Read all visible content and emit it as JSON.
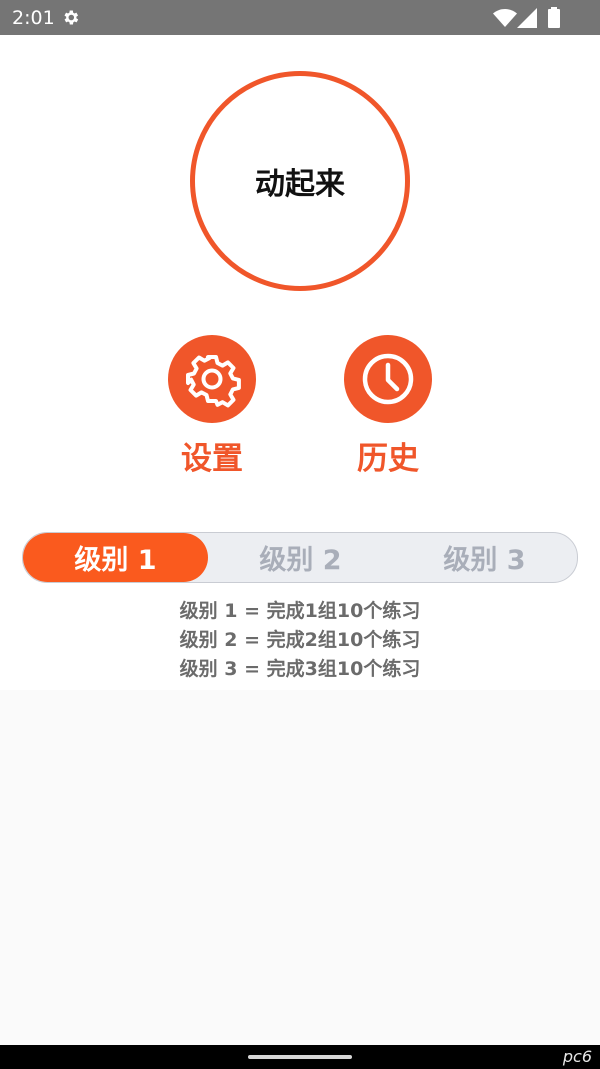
{
  "status_bar": {
    "time": "2:01",
    "icons": [
      "gear-icon",
      "wifi-icon",
      "signal-icon",
      "battery-icon"
    ]
  },
  "main": {
    "start_label": "动起来",
    "settings_label": "设置",
    "history_label": "历史",
    "levels": [
      {
        "label": "级别 1",
        "selected": true
      },
      {
        "label": "级别 2",
        "selected": false
      },
      {
        "label": "级别 3",
        "selected": false
      }
    ],
    "descriptions": [
      "级别 1 = 完成1组10个练习",
      "级别 2 = 完成2组10个练习",
      "级别 3 = 完成3组10个练习"
    ]
  },
  "watermark": "pc6",
  "colors": {
    "accent": "#f0562a",
    "selected_segment": "#fa5a1e",
    "status_bar": "#757575",
    "unselected_text": "#a9aeb9"
  }
}
